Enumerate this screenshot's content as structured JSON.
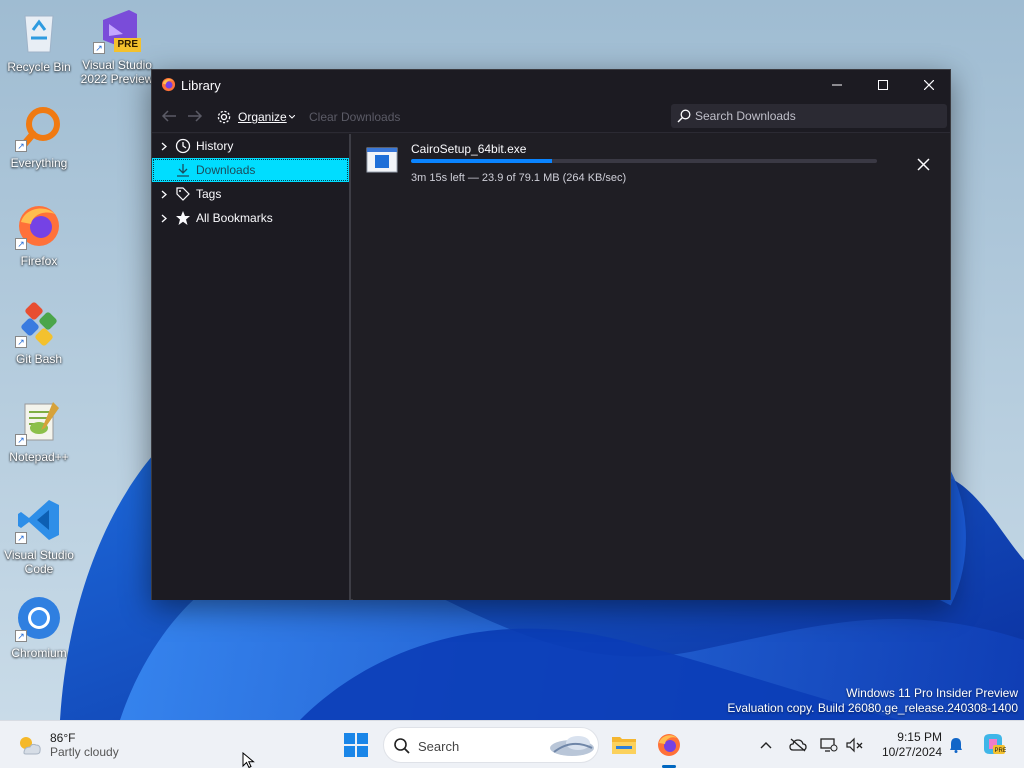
{
  "desktop": {
    "icons": [
      {
        "label": "Recycle Bin",
        "icon": "recycle-bin-icon"
      },
      {
        "label": "Visual Studio 2022 Preview",
        "badge": "PRE",
        "icon": "visual-studio-icon"
      },
      {
        "label": "Everything",
        "icon": "everything-search-icon"
      },
      {
        "label": "Firefox",
        "icon": "firefox-icon"
      },
      {
        "label": "Git Bash",
        "icon": "git-bash-icon"
      },
      {
        "label": "Notepad++",
        "icon": "notepad-plus-plus-icon"
      },
      {
        "label": "Visual Studio Code",
        "icon": "vscode-icon"
      },
      {
        "label": "Chromium",
        "icon": "chromium-icon"
      }
    ]
  },
  "library": {
    "title": "Library",
    "toolbar": {
      "organize_label": "Organize",
      "clear_downloads_label": "Clear Downloads",
      "search_placeholder": "Search Downloads"
    },
    "sidebar": {
      "items": [
        {
          "label": "History",
          "icon": "clock-icon",
          "expandable": true
        },
        {
          "label": "Downloads",
          "icon": "download-icon",
          "expandable": false,
          "selected": true
        },
        {
          "label": "Tags",
          "icon": "tag-icon",
          "expandable": true
        },
        {
          "label": "All Bookmarks",
          "icon": "star-icon",
          "expandable": true
        }
      ]
    },
    "download": {
      "filename": "CairoSetup_64bit.exe",
      "status": "3m 15s left — 23.9 of 79.1 MB (264 KB/sec)",
      "progress_fraction": 0.302
    }
  },
  "watermark": {
    "line1": "Windows 11 Pro Insider Preview",
    "line2": "Evaluation copy. Build 26080.ge_release.240308-1400"
  },
  "taskbar": {
    "weather": {
      "temp": "86°F",
      "condition": "Partly cloudy"
    },
    "search_label": "Search",
    "clock": {
      "time": "9:15 PM",
      "date": "10/27/2024"
    }
  },
  "colors": {
    "accent": "#00ddff",
    "progress": "#0a84ff",
    "window_bg": "#1f1e24",
    "taskbar_bg": "#eef1f6"
  }
}
